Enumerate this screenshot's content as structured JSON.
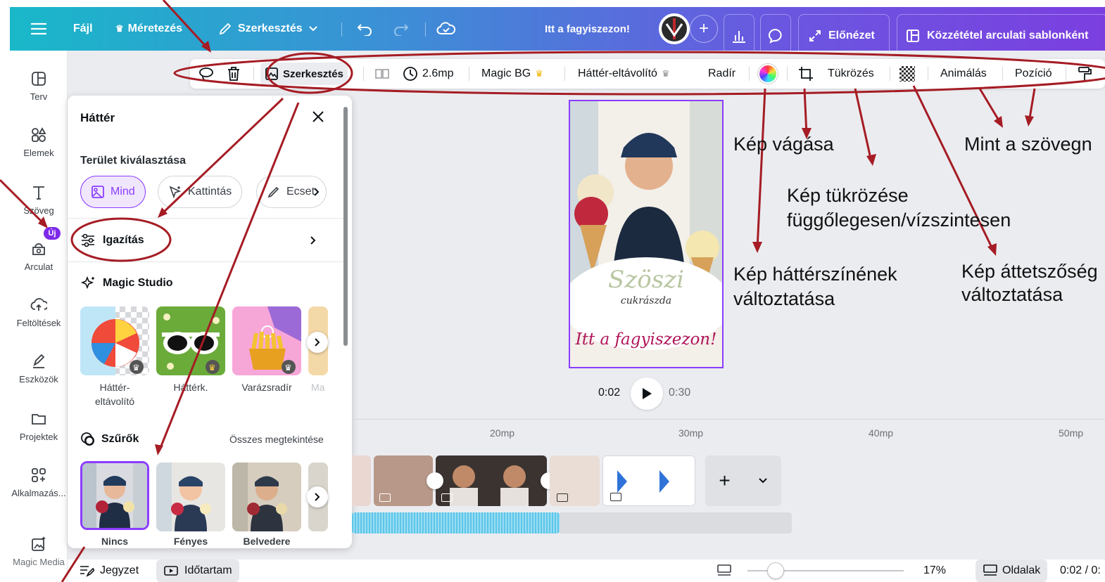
{
  "topbar": {
    "menu_icon": "hamburger-icon",
    "file_label": "Fájl",
    "resize_label": "Méretezés",
    "edit_label": "Szerkesztés",
    "design_title": "Itt a fagyiszezon!",
    "preview_label": "Előnézet",
    "publish_label": "Közzététel arculati sablonként"
  },
  "rail": {
    "items": [
      {
        "label": "Terv",
        "icon": "layout-icon"
      },
      {
        "label": "Elemek",
        "icon": "shapes-icon"
      },
      {
        "label": "Szöveg",
        "icon": "text-icon"
      },
      {
        "label": "Arculat",
        "icon": "brand-icon"
      },
      {
        "label": "Feltöltések",
        "icon": "upload-icon"
      },
      {
        "label": "Eszközök",
        "icon": "draw-icon"
      },
      {
        "label": "Projektek",
        "icon": "folder-icon"
      },
      {
        "label": "Alkalmazás...",
        "icon": "apps-icon"
      },
      {
        "label": "Magic Media",
        "icon": "magic-media-icon"
      }
    ],
    "new_badge": "Új"
  },
  "context_toolbar": {
    "edit_label": "Szerkesztés",
    "duration_label": "2.6mp",
    "magic_bg_label": "Magic BG",
    "bg_remover_label": "Háttér-eltávolító",
    "eraser_label": "Radír",
    "flip_label": "Tükrözés",
    "animate_label": "Animálás",
    "position_label": "Pozíció"
  },
  "panel": {
    "title": "Háttér",
    "area_select_label": "Terület kiválasztása",
    "chips": [
      "Mind",
      "Kattintás",
      "Ecset"
    ],
    "adjust_label": "Igazítás",
    "magic_studio_label": "Magic Studio",
    "magic_items": [
      "Háttér-\neltávolító",
      "Háttérk.",
      "Varázsradír",
      "Ma"
    ],
    "filters_label": "Szűrők",
    "see_all_label": "Összes megtekintése",
    "filter_items": [
      "Nincs",
      "Fényes",
      "Belvedere"
    ]
  },
  "page_preview": {
    "logo_line1": "Szöszi",
    "logo_line2": "cukrászda",
    "tagline": "Itt a fagyiszezon!"
  },
  "playback": {
    "current_time": "0:02",
    "total_time": "0:30"
  },
  "timeline": {
    "ruler_labels": [
      "20mp",
      "30mp",
      "40mp",
      "50mp"
    ]
  },
  "bottombar": {
    "notes_label": "Jegyzet",
    "duration_label": "Időtartam",
    "zoom_value": "17%",
    "pages_label": "Oldalak",
    "time_readout": "0:02 / 0:"
  },
  "annotations": {
    "crop": "Kép vágása",
    "mirror_line1": "Kép tükrözése",
    "mirror_line2": "függőlegesen/vízszintesen",
    "bgcolor_line1": "Kép háttérszínének",
    "bgcolor_line2": "változtatása",
    "transparency_line1": "Kép áttetszőség",
    "transparency_line2": "változtatása",
    "like_text": "Mint a szövegn"
  },
  "colors": {
    "accent": "#8b3dff",
    "annotation_red": "#a51c24",
    "crown": "#f0b400"
  }
}
